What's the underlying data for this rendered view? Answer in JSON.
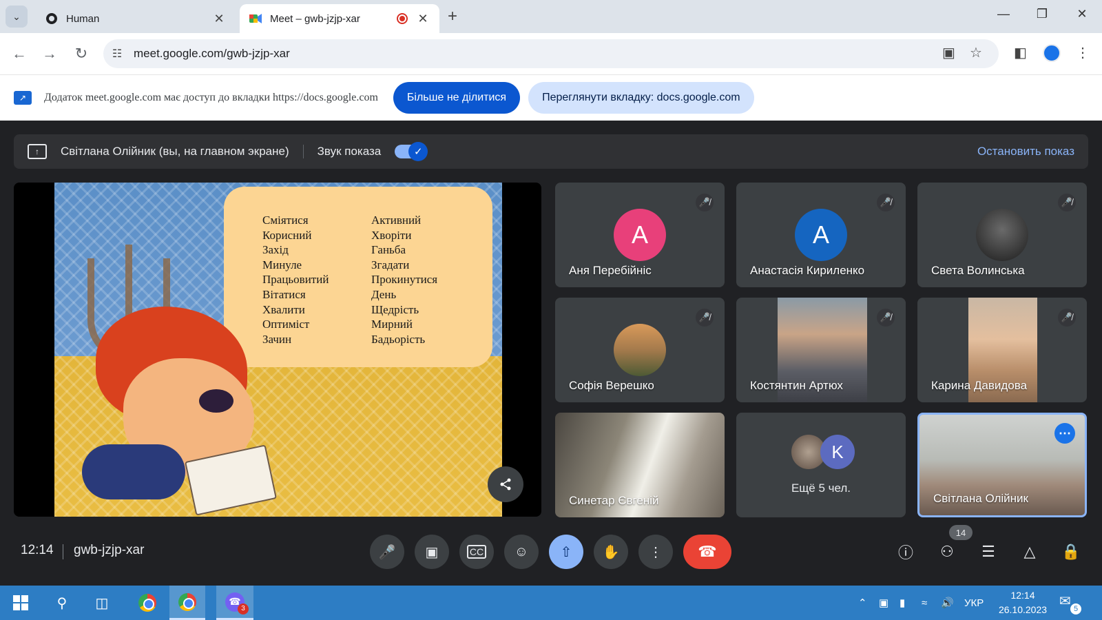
{
  "browser": {
    "tabs": [
      {
        "title": "Human",
        "icon": "human-favicon"
      },
      {
        "title": "Meet – gwb-jzjp-xar",
        "icon": "meet-favicon",
        "recording": true
      }
    ],
    "url": "meet.google.com/gwb-jzjp-xar"
  },
  "share_bar": {
    "message": "Додаток meet.google.com має доступ до вкладки https://docs.google.com",
    "stop_label": "Більше не ділитися",
    "view_label": "Переглянути вкладку: docs.google.com"
  },
  "presenting": {
    "presenter": "Світлана Олійник (вы, на главном экране)",
    "audio_label": "Звук показа",
    "audio_on": true,
    "stop_label": "Остановить показ"
  },
  "slide": {
    "col1": [
      "Сміятися",
      "Корисний",
      "Захід",
      "Минуле",
      "Працьовитий",
      "Вітатися",
      "Хвалити",
      "Оптиміст",
      "Зачин"
    ],
    "col2": [
      "Активний",
      "Хворіти",
      "Ганьба",
      "Згадати",
      "Прокинутися",
      "День",
      "Щедрість",
      "Мирний",
      "Бадьорість"
    ]
  },
  "participants": [
    {
      "name": "Аня Перебійніс",
      "initial": "А",
      "avatar_color": "#e8407a",
      "muted": true
    },
    {
      "name": "Анастасія Кириленко",
      "initial": "А",
      "avatar_color": "#1565c0",
      "muted": true
    },
    {
      "name": "Света Волинська",
      "muted": true
    },
    {
      "name": "Софія Верешко",
      "muted": true
    },
    {
      "name": "Костянтин Артюх",
      "muted": true
    },
    {
      "name": "Карина Давидова",
      "muted": true
    },
    {
      "name": "Синетар Євгеній",
      "muted": false
    }
  ],
  "more_tile": {
    "label": "Ещё 5 чел.",
    "initial": "K"
  },
  "self_tile": {
    "name": "Світлана Олійник"
  },
  "meeting": {
    "time": "12:14",
    "code": "gwb-jzjp-xar",
    "participant_count": "14"
  },
  "taskbar": {
    "language": "УКР",
    "time": "12:14",
    "date": "26.10.2023",
    "viber_badge": "3",
    "notification_badge": "5"
  }
}
